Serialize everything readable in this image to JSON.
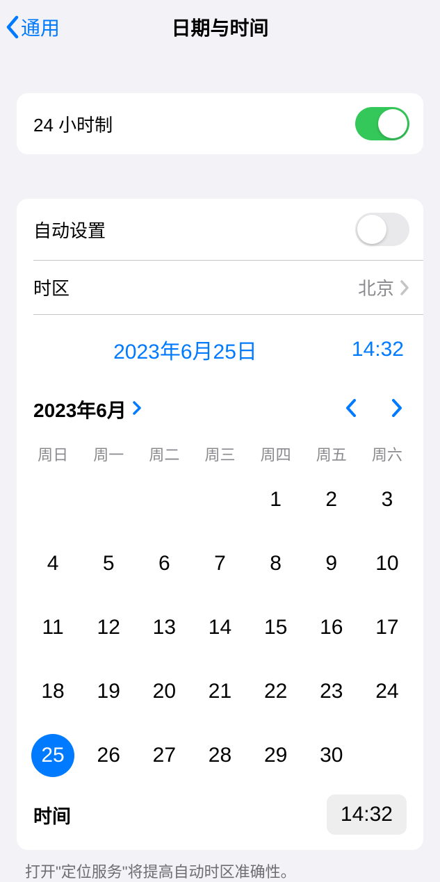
{
  "nav": {
    "back_label": "通用",
    "title": "日期与时间"
  },
  "settings": {
    "twenty_four_hour": {
      "label": "24 小时制",
      "value": true
    },
    "auto_set": {
      "label": "自动设置",
      "value": false
    },
    "timezone": {
      "label": "时区",
      "value": "北京"
    }
  },
  "current": {
    "date_string": "2023年6月25日",
    "time_string": "14:32"
  },
  "calendar": {
    "month_label": "2023年6月",
    "weekdays": [
      "周日",
      "周一",
      "周二",
      "周三",
      "周四",
      "周五",
      "周六"
    ],
    "leading_blanks": 4,
    "days_in_month": 30,
    "selected_day": 25
  },
  "time_row": {
    "label": "时间",
    "value": "14:32"
  },
  "footer_note": "打开\"定位服务\"将提高自动时区准确性。"
}
